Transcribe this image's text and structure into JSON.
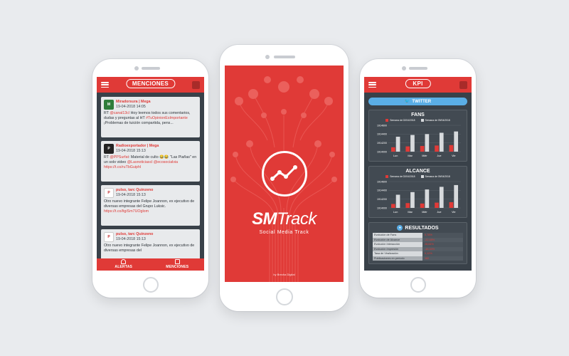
{
  "colors": {
    "accent": "#e03a37",
    "dark": "#394149",
    "twitter": "#5aaee6",
    "bar_light": "#d7dadd"
  },
  "left_phone": {
    "title": "MENCIONES",
    "posts": [
      {
        "author": "Miradorsura | Mega",
        "date": "19-04-2018  14:05",
        "text_prefix": "RT ",
        "text_red": "@canal13cl",
        "text_main": " Hoy leemos todos sus comentarios, dudas y preguntas al HT ",
        "text_tag": "#TuOpinionEsImportante",
        "text_end": " ¡Problemas de tuición compartida, pens..."
      },
      {
        "author": "Radioexportador | Mega",
        "date": "19-04-2018  15:13",
        "text_prefix": "RT ",
        "text_red": "@PPSurfat",
        "text_main": ": Material de culto 😂😂 \"Las Piañas\" en un solo video ",
        "text_tag": "@Lasnoticiascl @ecosocialvia https://t.co/ruTbGuiphl",
        "text_end": ""
      },
      {
        "author": "pulso, tarc Quinzeno",
        "date": "19-04-2018  15:13",
        "text_prefix": "",
        "text_red": "",
        "text_main": "Otro nuevo integrante Felipe Joannon, ex ejecutivo de diversas empresas del Grupo Luksic. ",
        "text_tag": "https://t.co/ltgiSm7UOglom",
        "text_end": ""
      },
      {
        "author": "pulso, tarc Quinzeno",
        "date": "19-04-2018  15:13",
        "text_prefix": "",
        "text_red": "",
        "text_main": "Otro nuevo integrante Felipe Joannon, ex ejecutivo de diversas empresas del",
        "text_tag": "",
        "text_end": ""
      }
    ],
    "nav": [
      {
        "label": "ALERTAS",
        "icon": "bell-icon"
      },
      {
        "label": "MENCIONES",
        "icon": "chat-icon"
      }
    ]
  },
  "center_phone": {
    "brand_a": "SM",
    "brand_b": "Track",
    "tagline": "Social Media Track",
    "credits": "by Brecha Digital"
  },
  "right_phone": {
    "title": "KPI",
    "twitter_label": "TWITTER",
    "fans": {
      "title": "FANS",
      "legend": [
        "Semana de 02/04/2018",
        "Semana de 09/04/2018"
      ]
    },
    "alcance": {
      "title": "ALCANCE",
      "legend": [
        "Semana de 02/04/2018",
        "Semana de 09/04/2018"
      ]
    },
    "resultados": {
      "title": "RESULTADOS",
      "rows": [
        {
          "label": "Evolución de Fans",
          "value": "0,78%"
        },
        {
          "label": "Evolución de Alcance",
          "value": "-22,48%"
        },
        {
          "label": "Evolución Interacción",
          "value": "28,84%"
        },
        {
          "label": "Evolución Impresión",
          "value": "-48,34%"
        },
        {
          "label": "Tasa de Viralización",
          "value": "0,12%"
        },
        {
          "label": "Publicaciones en período",
          "value": "182"
        }
      ]
    }
  },
  "chart_data": [
    {
      "type": "bar",
      "title": "FANS",
      "categories": [
        "Lun",
        "Mar",
        "Miér",
        "Jue",
        "Vie"
      ],
      "yticks": [
        "1914600",
        "1914400",
        "1914200",
        "1914000"
      ],
      "ylim": [
        1914000,
        1914600
      ],
      "series": [
        {
          "name": "Semana de 02/04/2018",
          "values": [
            1914100,
            1914120,
            1914130,
            1914140,
            1914150
          ]
        },
        {
          "name": "Semana de 09/04/2018",
          "values": [
            1914340,
            1914380,
            1914400,
            1914430,
            1914460
          ]
        }
      ]
    },
    {
      "type": "bar",
      "title": "ALCANCE",
      "categories": [
        "Lun",
        "Mar",
        "Miér",
        "Jue",
        "Vie"
      ],
      "yticks": [
        "1914600",
        "1914400",
        "1914200",
        "1914000"
      ],
      "ylim": [
        1914000,
        1914600
      ],
      "series": [
        {
          "name": "Semana de 02/04/2018",
          "values": [
            1914090,
            1914110,
            1914100,
            1914120,
            1914130
          ]
        },
        {
          "name": "Semana de 09/04/2018",
          "values": [
            1914300,
            1914360,
            1914420,
            1914480,
            1914520
          ]
        }
      ]
    }
  ]
}
